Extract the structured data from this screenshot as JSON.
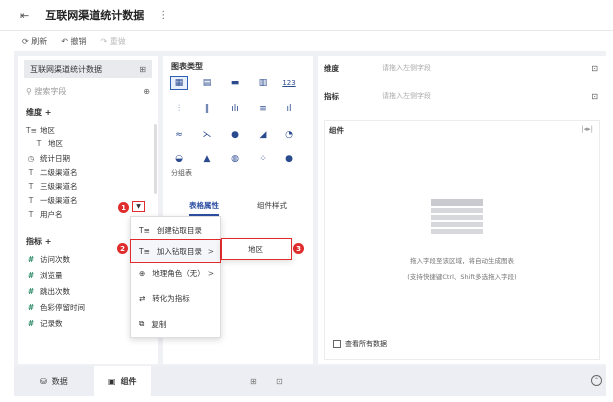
{
  "header": {
    "title": "互联网渠道统计数据",
    "back_icon": "collapse-icon",
    "more_icon": "more-icon"
  },
  "toolbar": {
    "refresh": "刷新",
    "undo": "撤销",
    "redo": "重做"
  },
  "left_panel": {
    "dataset_name": "互联网渠道统计数据",
    "search_placeholder": "搜索字段",
    "dimension_label": "维度",
    "dimension_add": "+",
    "dimensions": [
      {
        "icon": "T≡",
        "label": "地区"
      },
      {
        "icon": "T",
        "label": "地区"
      },
      {
        "icon": "◷",
        "label": "统计日期"
      },
      {
        "icon": "T",
        "label": "二级渠道名"
      },
      {
        "icon": "T",
        "label": "三级渠道名"
      },
      {
        "icon": "T",
        "label": "一级渠道名"
      },
      {
        "icon": "T",
        "label": "用户名"
      }
    ],
    "metric_label": "指标",
    "metric_add": "+",
    "metrics": [
      {
        "icon": "#",
        "label": "访问次数"
      },
      {
        "icon": "#",
        "label": "浏览量"
      },
      {
        "icon": "#",
        "label": "跳出次数"
      },
      {
        "icon": "#",
        "label": "色彩停留时间"
      },
      {
        "icon": "#",
        "label": "记录数"
      }
    ]
  },
  "middle_panel": {
    "chart_type_label": "图表类型",
    "number_chart_glyph": "123",
    "group_table_label": "分组表",
    "tabs": [
      "表格属性",
      "组件样式"
    ]
  },
  "right_panel": {
    "dimension_label": "维度",
    "dimension_placeholder": "请拖入左侧字段",
    "metric_label": "指标",
    "metric_placeholder": "请拖入左侧字段",
    "component_label": "组件",
    "hint1": "拖入字段至该区域，将自动生成图表",
    "hint2": "(支持快捷键Ctrl、Shift多选拖入字段)",
    "show_all": "查看所有数据"
  },
  "context_menu": {
    "items": [
      {
        "icon": "T≡",
        "label": "创建钻取目录"
      },
      {
        "icon": "T≡",
        "label": "加入钻取目录",
        "arrow": ">"
      },
      {
        "icon": "⊕",
        "label": "地理角色（无）",
        "arrow": ">"
      },
      {
        "icon": "⇄",
        "label": "转化为指标"
      },
      {
        "icon": "⧉",
        "label": "复制"
      }
    ],
    "submenu_item": "地区"
  },
  "badges": [
    "1",
    "2",
    "3"
  ],
  "bottom_bar": {
    "data_tab": "数据",
    "component_tab": "组件"
  },
  "colors": {
    "accent": "#2d4ea3",
    "highlight": "#e02c2c",
    "metric": "#2a8a66"
  }
}
